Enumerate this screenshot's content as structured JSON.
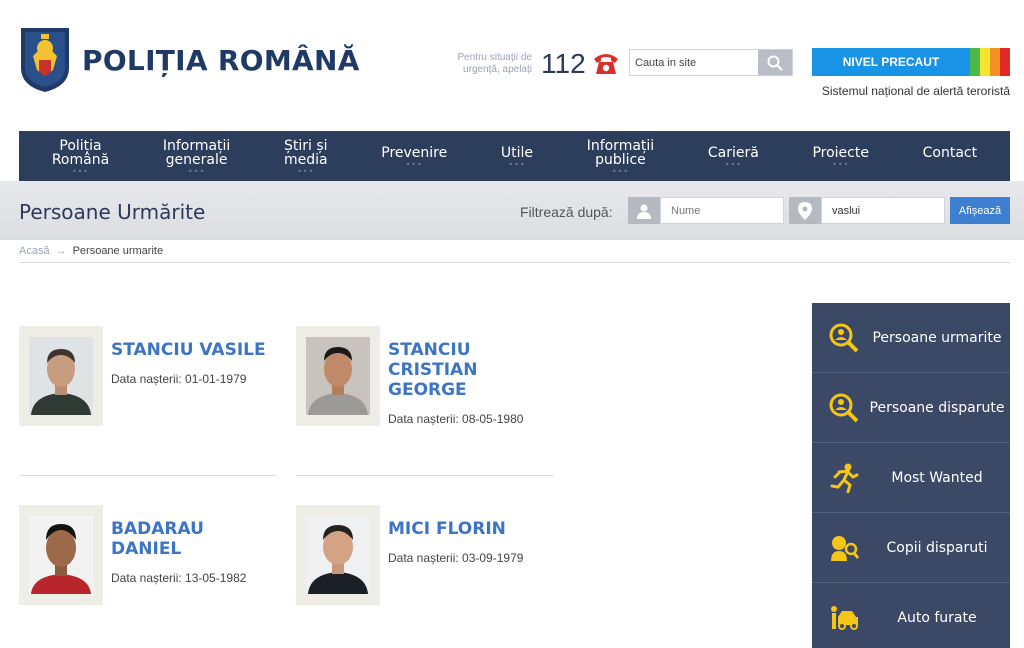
{
  "header": {
    "brand": "POLIȚIA ROMÂNĂ",
    "emergency_text": "Pentru situații de urgență, apelați",
    "emergency_number": "112",
    "search_placeholder": "Cauta in site",
    "alert_level": "NIVEL PRECAUT",
    "alert_subtitle": "Sistemul național de alertă teroristă",
    "alert_colors": [
      "#1993e6",
      "#4cb848",
      "#f6e431",
      "#f39223",
      "#e42a25"
    ]
  },
  "nav": {
    "items": [
      {
        "line1": "Poliția",
        "line2": "Română"
      },
      {
        "line1": "Informații",
        "line2": "generale"
      },
      {
        "line1": "Știri și",
        "line2": "media"
      },
      {
        "line1": "Prevenire",
        "line2": ""
      },
      {
        "line1": "Utile",
        "line2": ""
      },
      {
        "line1": "Informații",
        "line2": "publice"
      },
      {
        "line1": "Carieră",
        "line2": ""
      },
      {
        "line1": "Proiecte",
        "line2": ""
      },
      {
        "line1": "Contact",
        "line2": ""
      }
    ],
    "dots": "•••"
  },
  "titlebar": {
    "title": "Persoane Urmărite",
    "filter_label": "Filtrează după:",
    "name_placeholder": "Nume",
    "location_value": "vaslui",
    "submit_label": "Afișează"
  },
  "breadcrumb": {
    "home": "Acasă",
    "separator": "→",
    "current": "Persoane urmarite"
  },
  "persons": [
    {
      "name": "STANCIU VASILE",
      "dob": "Data nașterii: 01-01-1979"
    },
    {
      "name": "STANCIU CRISTIAN GEORGE",
      "dob": "Data nașterii: 08-05-1980"
    },
    {
      "name": "BADARAU DANIEL",
      "dob": "Data nașterii: 13-05-1982"
    },
    {
      "name": "MICI FLORIN",
      "dob": "Data nașterii: 03-09-1979"
    }
  ],
  "sidebar": {
    "items": [
      {
        "label": "Persoane urmarite",
        "icon": "search-person-icon"
      },
      {
        "label": "Persoane disparute",
        "icon": "search-person-icon"
      },
      {
        "label": "Most Wanted",
        "icon": "running-man-icon"
      },
      {
        "label": "Copii disparuti",
        "icon": "child-icon"
      },
      {
        "label": "Auto furate",
        "icon": "car-icon"
      }
    ],
    "icon_color": "#f5c518"
  }
}
